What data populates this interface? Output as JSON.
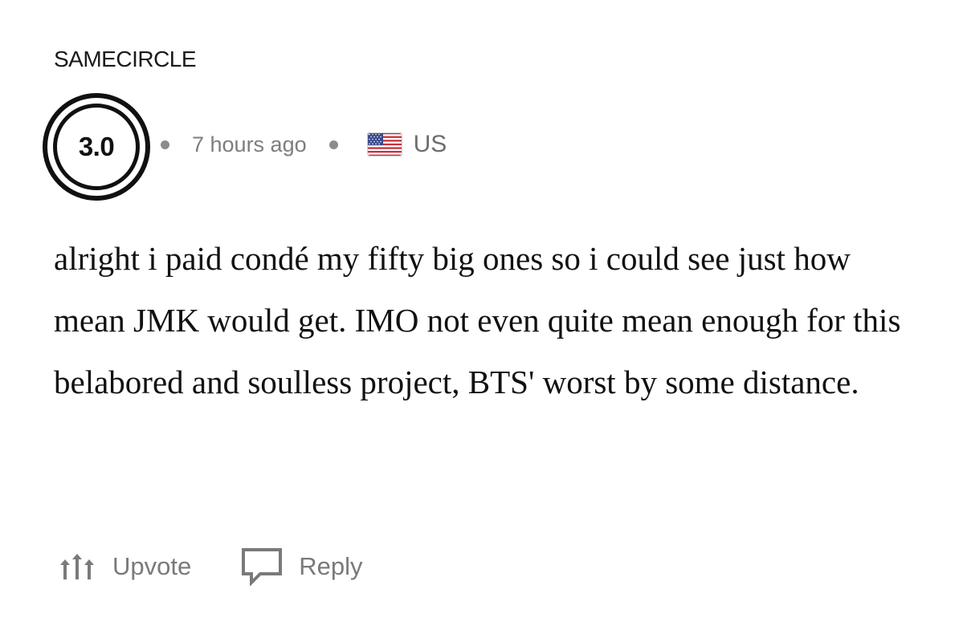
{
  "comment": {
    "username": "SAMECIRCLE",
    "score": "3.0",
    "time": "7 hours ago",
    "country": "US",
    "flag_icon": "us-flag-icon",
    "text": "alright i paid condé my fifty big ones so i could see just how mean JMK would get. IMO not even quite mean enough for this belabored and soulless project, BTS' worst by some distance."
  },
  "actions": {
    "upvote_label": "Upvote",
    "upvote_icon": "upvote-icon",
    "reply_label": "Reply",
    "reply_icon": "reply-icon"
  },
  "colors": {
    "text": "#111111",
    "muted": "#7a7a7a",
    "background": "#ffffff"
  }
}
